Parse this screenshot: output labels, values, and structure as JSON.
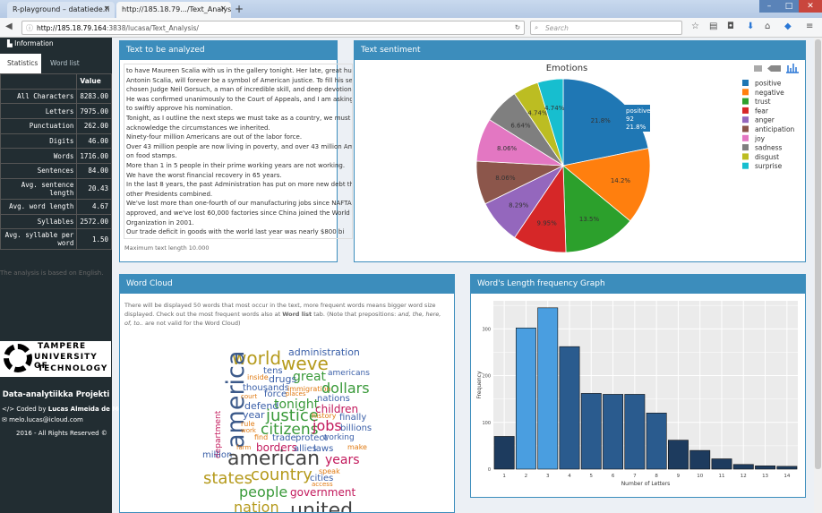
{
  "browser": {
    "tabs": [
      {
        "label": "R-playground – datatiede.fi"
      },
      {
        "label": "http://185.18.79.../Text_Analysis/"
      }
    ],
    "url_host": "http://185.18.79.164",
    "url_path": ":3838/lucasa/Text_Analysis/",
    "search_placeholder": "Search"
  },
  "sidebar": {
    "info": "Information",
    "tabs": [
      "Statistics",
      "Word list"
    ],
    "table_header": "Value",
    "stats": [
      {
        "label": "All Characters",
        "value": "8283.00"
      },
      {
        "label": "Letters",
        "value": "7975.00"
      },
      {
        "label": "Punctuation",
        "value": "262.00"
      },
      {
        "label": "Digits",
        "value": "46.00"
      },
      {
        "label": "Words",
        "value": "1716.00"
      },
      {
        "label": "Sentences",
        "value": "84.00"
      },
      {
        "label": "Avg. sentence length",
        "value": "20.43"
      },
      {
        "label": "Avg. word length",
        "value": "4.67"
      },
      {
        "label": "Syllables",
        "value": "2572.00"
      },
      {
        "label": "Avg. syllable per word",
        "value": "1.50"
      }
    ],
    "note": "The analysis is based on English.",
    "logo_lines": [
      "TAMPERE",
      "UNIVERSITY OF",
      "TECHNOLOGY"
    ],
    "project": "Data-analytiikka Projekti",
    "coded_prefix": "Coded by",
    "coded_name": "Lucas Almeida de Melo",
    "email": "melo.lucas@icloud.com",
    "copyright": "2016 - All Rights Reserved"
  },
  "text_panel": {
    "title": "Text to be analyzed",
    "lines": [
      "to have Maureen Scalia with us in the gallery tonight. Her late, great husband,",
      "Antonin Scalia, will forever be a symbol of American justice. To fill his seat, we have",
      "chosen Judge Neil Gorsuch, a man of incredible skill, and deep devotion to the law.",
      "He was confirmed unanimously to the Court of Appeals, and I am asking the Senate",
      "to swiftly approve his nomination.",
      "Tonight, as I outline the next steps we must take as a country, we must honestly",
      "acknowledge the circumstances we inherited.",
      "Ninety-four million Americans are out of the labor force.",
      "Over 43 million people are now living in poverty, and over 43 million Americans are",
      "on food stamps.",
      "More than 1 in 5 people in their prime working years are not working.",
      "We have the worst financial recovery in 65 years.",
      "In the last 8 years, the past Administration has put on more new debt than nearly all",
      "other Presidents combined.",
      "We've lost more than one-fourth of our manufacturing jobs since NAFTA was",
      "approved, and we've lost 60,000 factories since China joined the World Trade",
      "Organization in 2001.",
      "Our trade deficit in goods with the world last year was nearly $800 bi"
    ],
    "max_length": "Maximum text length 10.000"
  },
  "sentiment_panel": {
    "title": "Text sentiment",
    "tooltip": [
      "positive",
      "92",
      "21.8%"
    ]
  },
  "cloud_panel": {
    "title": "Word Cloud",
    "desc_1": "There will be displayed 50 words that most occur in the text, more frequent words means bigger word size displayed. Check out the most frequent words also at ",
    "desc_bold": "Word list",
    "desc_2": " tab. (Note that prepositions: ",
    "desc_italic": "and, the, here, of, to..",
    "desc_3": " are not valid for the Word Cloud)",
    "words": [
      {
        "t": "administration",
        "c": "#3a5fa8"
      },
      {
        "t": "world",
        "c": "#b59a1c"
      },
      {
        "t": "weve",
        "c": "#b59a1c"
      },
      {
        "t": "tens",
        "c": "#3a5fa8"
      },
      {
        "t": "americans",
        "c": "#3a5fa8"
      },
      {
        "t": "inside",
        "c": "#e07a12"
      },
      {
        "t": "drugs",
        "c": "#3a5fa8"
      },
      {
        "t": "great",
        "c": "#3a9a3a"
      },
      {
        "t": "america",
        "c": "#3c5a8a"
      },
      {
        "t": "thousands",
        "c": "#3a5fa8"
      },
      {
        "t": "immigration",
        "c": "#e07a12"
      },
      {
        "t": "dollars",
        "c": "#3a9a3a"
      },
      {
        "t": "department",
        "c": "#c2185b"
      },
      {
        "t": "court",
        "c": "#e07a12"
      },
      {
        "t": "force",
        "c": "#3a5fa8"
      },
      {
        "t": "places",
        "c": "#e07a12"
      },
      {
        "t": "nations",
        "c": "#3a5fa8"
      },
      {
        "t": "defend",
        "c": "#3a5fa8"
      },
      {
        "t": "tonight",
        "c": "#3a9a3a"
      },
      {
        "t": "children",
        "c": "#c2185b"
      },
      {
        "t": "year",
        "c": "#3a5fa8"
      },
      {
        "t": "justice",
        "c": "#3a9a3a"
      },
      {
        "t": "history",
        "c": "#e07a12"
      },
      {
        "t": "rule",
        "c": "#e07a12"
      },
      {
        "t": "finally",
        "c": "#3a5fa8"
      },
      {
        "t": "work",
        "c": "#e07a12"
      },
      {
        "t": "citizens",
        "c": "#3a9a3a"
      },
      {
        "t": "jobs",
        "c": "#c2185b"
      },
      {
        "t": "find",
        "c": "#e07a12"
      },
      {
        "t": "trade",
        "c": "#3a5fa8"
      },
      {
        "t": "protect",
        "c": "#3a5fa8"
      },
      {
        "t": "billions",
        "c": "#3a5fa8"
      },
      {
        "t": "farm",
        "c": "#e07a12"
      },
      {
        "t": "borders",
        "c": "#c2185b"
      },
      {
        "t": "allies",
        "c": "#3a5fa8"
      },
      {
        "t": "laws",
        "c": "#3a5fa8"
      },
      {
        "t": "working",
        "c": "#3a5fa8"
      },
      {
        "t": "make",
        "c": "#e07a12"
      },
      {
        "t": "million",
        "c": "#3a5fa8"
      },
      {
        "t": "american",
        "c": "#444444"
      },
      {
        "t": "years",
        "c": "#c2185b"
      },
      {
        "t": "speak",
        "c": "#e07a12"
      },
      {
        "t": "states",
        "c": "#b59a1c"
      },
      {
        "t": "country",
        "c": "#b59a1c"
      },
      {
        "t": "cities",
        "c": "#3a5fa8"
      },
      {
        "t": "access",
        "c": "#e07a12"
      },
      {
        "t": "people",
        "c": "#3a9a3a"
      },
      {
        "t": "government",
        "c": "#c2185b"
      },
      {
        "t": "nation",
        "c": "#b59a1c"
      },
      {
        "t": "united",
        "c": "#444444"
      }
    ]
  },
  "length_panel": {
    "title": "Word's Length frequency Graph"
  },
  "chart_data": [
    {
      "type": "pie",
      "title": "Emotions",
      "labels": [
        "positive",
        "negative",
        "trust",
        "fear",
        "anger",
        "anticipation",
        "joy",
        "sadness",
        "disgust",
        "surprise"
      ],
      "percent_labels": [
        "21.8%",
        "14.2%",
        "13.5%",
        "9.95%",
        "8.29%",
        "8.06%",
        "8.06%",
        "6.64%",
        "4.74%",
        "4.74%"
      ],
      "values": [
        21.8,
        14.2,
        13.5,
        9.95,
        8.29,
        8.06,
        8.06,
        6.64,
        4.74,
        4.74
      ],
      "colors": [
        "#1f77b4",
        "#ff7f0e",
        "#2ca02c",
        "#d62728",
        "#9467bd",
        "#8c564b",
        "#e377c2",
        "#7f7f7f",
        "#bcbd22",
        "#17becf"
      ],
      "legend": "right"
    },
    {
      "type": "bar",
      "categories": [
        "1",
        "2",
        "3",
        "4",
        "5",
        "6",
        "7",
        "8",
        "9",
        "10",
        "11",
        "12",
        "13",
        "14"
      ],
      "values": [
        70,
        302,
        345,
        262,
        162,
        160,
        160,
        120,
        62,
        40,
        22,
        10,
        7,
        6
      ],
      "xlabel": "Number of Letters",
      "ylabel": "Frequency",
      "yticks": [
        "0",
        "100",
        "200",
        "300"
      ],
      "ylim": [
        0,
        360
      ],
      "colors": [
        "#1d3b5e",
        "#4a9ee0",
        "#4a9ee0",
        "#2a5b8e",
        "#2a5b8e",
        "#2a5b8e",
        "#2a5b8e",
        "#2a5b8e",
        "#1d3b5e",
        "#1d3b5e",
        "#1d3b5e",
        "#1d3b5e",
        "#1d3b5e",
        "#1d3b5e"
      ],
      "grid": true
    }
  ]
}
